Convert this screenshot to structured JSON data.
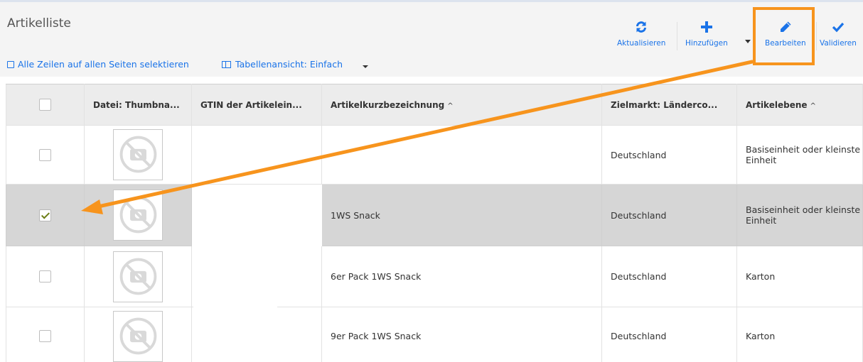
{
  "header": {
    "title": "Artikelliste",
    "select_all": "Alle Zeilen auf allen Seiten selektieren",
    "table_view": "Tabellenansicht: Einfach"
  },
  "toolbar": {
    "refresh_label": "Aktualisieren",
    "add_label": "Hinzufügen",
    "edit_label": "Bearbeiten",
    "validate_label": "Validieren"
  },
  "table": {
    "columns": [
      {
        "label": "Datei: Thumbna...",
        "sortable": false
      },
      {
        "label": "GTIN der Artikelein...",
        "sortable": false
      },
      {
        "label": "Artikelkurzbezeichnung",
        "sort": "^"
      },
      {
        "label": "Zielmarkt: Länderco...",
        "sortable": false
      },
      {
        "label": "Artikelebene",
        "sort": "^"
      }
    ],
    "rows": [
      {
        "checked": false,
        "name": "",
        "market": "Deutschland",
        "level": "Basiseinheit oder kleinste Einheit"
      },
      {
        "checked": true,
        "name": "1WS Snack",
        "market": "Deutschland",
        "level": "Basiseinheit oder kleinste Einheit"
      },
      {
        "checked": false,
        "name": "6er Pack 1WS Snack",
        "market": "Deutschland",
        "level": "Karton"
      },
      {
        "checked": false,
        "name": "9er Pack 1WS Snack",
        "market": "Deutschland",
        "level": "Karton"
      }
    ]
  },
  "colors": {
    "accent": "#1a73e8",
    "highlight": "#f7941d",
    "selected_row": "#d6d6d6"
  }
}
